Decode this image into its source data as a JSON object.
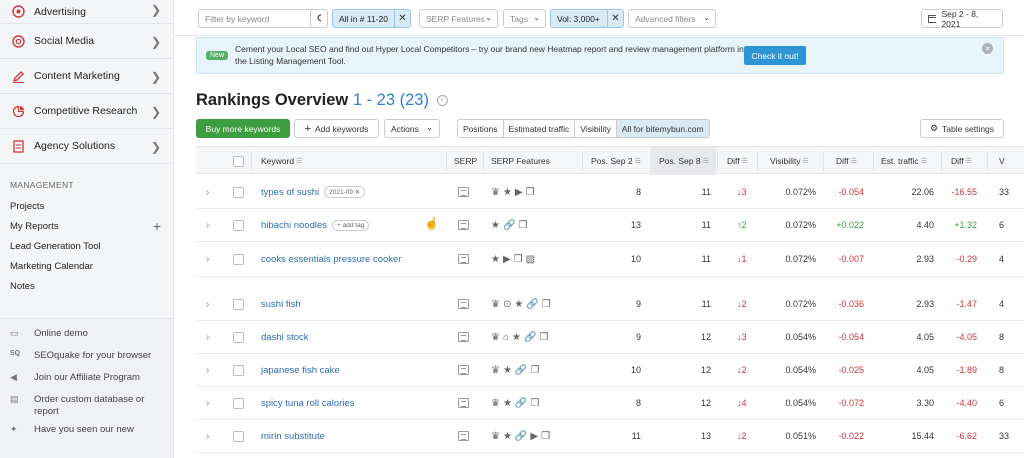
{
  "sidebar": {
    "nav": [
      {
        "label": "Advertising",
        "icon": "target-icon"
      },
      {
        "label": "Social Media",
        "icon": "social-icon"
      },
      {
        "label": "Content Marketing",
        "icon": "pen-icon"
      },
      {
        "label": "Competitive Research",
        "icon": "pie-icon"
      },
      {
        "label": "Agency Solutions",
        "icon": "document-icon"
      }
    ],
    "management_title": "MANAGEMENT",
    "management": [
      "Projects",
      "My Reports",
      "Lead Generation Tool",
      "Marketing Calendar",
      "Notes"
    ],
    "bottom": [
      {
        "label": "Online demo",
        "icon": "monitor-icon"
      },
      {
        "label": "SEOquake for your browser",
        "icon": "seoquake-icon"
      },
      {
        "label": "Join our Affiliate Program",
        "icon": "megaphone-icon"
      },
      {
        "label": "Order custom database or report",
        "icon": "report-icon"
      },
      {
        "label": "Have you seen our new",
        "icon": "sparkle-icon"
      }
    ]
  },
  "filters": {
    "keyword_placeholder": "Filter by keyword",
    "position": "All in # 11-20",
    "serp_features": "SERP Features",
    "tags": "Tags",
    "volume": "Vol: 3,000+",
    "advanced": "Advanced filters",
    "date_range": "Sep 2 - 8, 2021"
  },
  "banner": {
    "badge": "New",
    "message": "Cement your Local SEO and find out Hyper Local Competitors – try our brand new Heatmap report and review management platform in the Listing Management Tool.",
    "cta": "Check it out!"
  },
  "title": {
    "text": "Rankings Overview",
    "range": "1 - 23 (23)"
  },
  "toolbar": {
    "buy_keywords": "Buy more keywords",
    "add_keywords": "Add keywords",
    "actions": "Actions",
    "tabs": [
      "Positions",
      "Estimated traffic",
      "Visibility",
      "All for bitemybun.com"
    ],
    "table_settings": "Table settings"
  },
  "table": {
    "headers": [
      "Keyword",
      "SERP",
      "SERP Features",
      "Pos. Sep 2",
      "Pos. Sep 8",
      "Diff",
      "Visibility",
      "Diff",
      "Est. traffic",
      "Diff",
      "V"
    ],
    "add_tag": "add tag",
    "rows": [
      {
        "keyword": "types of sushi",
        "tag": "2021-09",
        "features": "♛★▶❐",
        "pos_a": "8",
        "pos_b": "11",
        "pos_diff": "↓3",
        "pos_dir": "dn",
        "vis": "0.072%",
        "vis_diff": "-0.054",
        "traffic": "22.06",
        "traffic_diff": "-16.55",
        "v": "33"
      },
      {
        "keyword": "hibachi noodles",
        "tag": "",
        "add_tag": true,
        "features": "★🔗❐",
        "pos_a": "13",
        "pos_b": "11",
        "pos_diff": "↑2",
        "pos_dir": "up",
        "vis": "0.072%",
        "vis_diff": "+0.022",
        "traffic": "4.40",
        "traffic_diff": "+1.32",
        "v": "6"
      },
      {
        "keyword": "cooks essentials pressure cooker",
        "tag": "",
        "features": "★▶❐▨",
        "pos_a": "10",
        "pos_b": "11",
        "pos_diff": "↓1",
        "pos_dir": "dn",
        "vis": "0.072%",
        "vis_diff": "-0.007",
        "traffic": "2.93",
        "traffic_diff": "-0.29",
        "v": "4"
      },
      {
        "keyword": "sushi fish",
        "tag": "",
        "features": "♛⊙★🔗❐",
        "pos_a": "9",
        "pos_b": "11",
        "pos_diff": "↓2",
        "pos_dir": "dn",
        "vis": "0.072%",
        "vis_diff": "-0.036",
        "traffic": "2.93",
        "traffic_diff": "-1.47",
        "v": "4"
      },
      {
        "keyword": "dashi stock",
        "tag": "",
        "features": "♛⌂★🔗❐",
        "pos_a": "9",
        "pos_b": "12",
        "pos_diff": "↓3",
        "pos_dir": "dn",
        "vis": "0.054%",
        "vis_diff": "-0.054",
        "traffic": "4.05",
        "traffic_diff": "-4.05",
        "v": "8"
      },
      {
        "keyword": "japanese fish cake",
        "tag": "",
        "features": "♛★🔗❐",
        "pos_a": "10",
        "pos_b": "12",
        "pos_diff": "↓2",
        "pos_dir": "dn",
        "vis": "0.054%",
        "vis_diff": "-0.025",
        "traffic": "4.05",
        "traffic_diff": "-1.89",
        "v": "8"
      },
      {
        "keyword": "spicy tuna roll calories",
        "tag": "",
        "features": "♛★🔗❐",
        "pos_a": "8",
        "pos_b": "12",
        "pos_diff": "↓4",
        "pos_dir": "dn",
        "vis": "0.054%",
        "vis_diff": "-0.072",
        "traffic": "3.30",
        "traffic_diff": "-4.40",
        "v": "6"
      },
      {
        "keyword": "mirin substitute",
        "tag": "",
        "features": "♛★🔗▶❐",
        "pos_a": "11",
        "pos_b": "13",
        "pos_diff": "↓2",
        "pos_dir": "dn",
        "vis": "0.051%",
        "vis_diff": "-0.022",
        "traffic": "15.44",
        "traffic_diff": "-6.62",
        "v": "33"
      }
    ]
  },
  "colors": {
    "accent": "#2f7fd0",
    "green": "#3d9d3f",
    "red": "#d0363a"
  }
}
